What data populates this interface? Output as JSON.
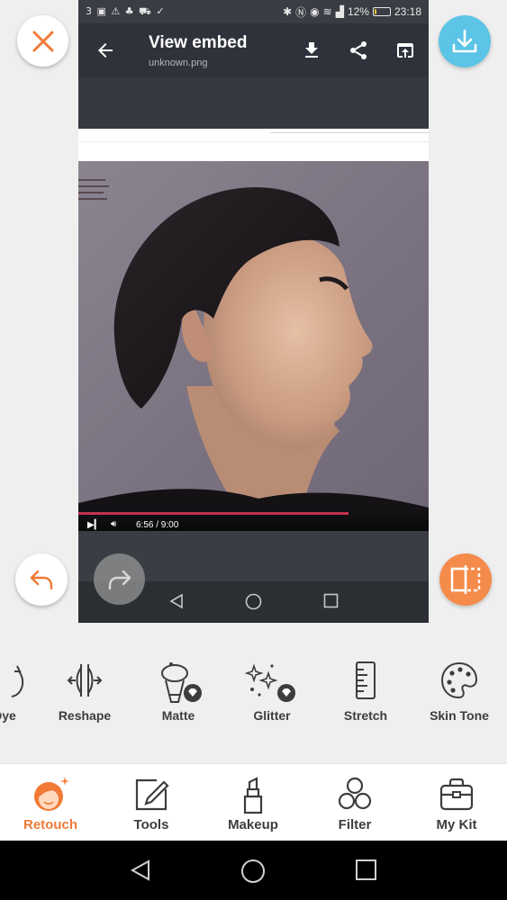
{
  "embed": {
    "status_left": "3 ▣ ⚠ ♣ ⛟ ✓",
    "battery_text": "12%",
    "battery_level": 0.12,
    "clock": "23:18",
    "title": "View embed",
    "filename": "unknown.png",
    "video_time": "6:56 / 9:00",
    "video_progress": 0.77
  },
  "tools": [
    {
      "label": "Dye",
      "icon": "dye-icon"
    },
    {
      "label": "Reshape",
      "icon": "reshape-icon"
    },
    {
      "label": "Matte",
      "icon": "matte-icon"
    },
    {
      "label": "Glitter",
      "icon": "glitter-icon"
    },
    {
      "label": "Stretch",
      "icon": "stretch-icon"
    },
    {
      "label": "Skin Tone",
      "icon": "skin-tone-icon"
    }
  ],
  "tabs": [
    {
      "label": "Retouch",
      "icon": "retouch-face-icon",
      "active": true
    },
    {
      "label": "Tools",
      "icon": "pencil-square-icon"
    },
    {
      "label": "Makeup",
      "icon": "lipstick-icon"
    },
    {
      "label": "Filter",
      "icon": "three-circles-icon"
    },
    {
      "label": "My Kit",
      "icon": "kit-bag-icon"
    }
  ],
  "colors": {
    "accent": "#f07a36",
    "download": "#5cc4e6",
    "compare": "#f58b4a",
    "progress": "#c3324d"
  }
}
